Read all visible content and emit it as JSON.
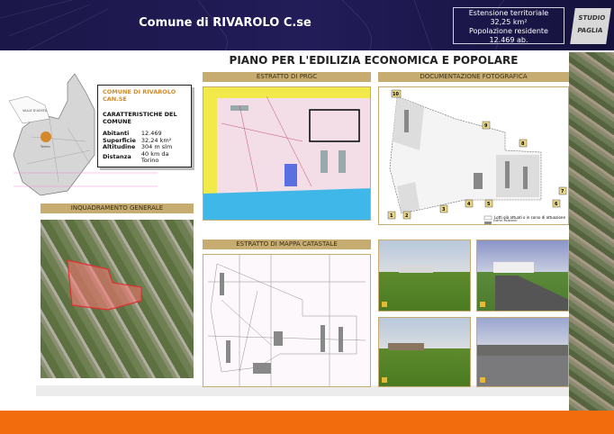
{
  "header": {
    "title": "Comune di RIVAROLO C.se",
    "info": {
      "line1": "Estensione territoriale",
      "line2": "32,25 km²",
      "line3": "Popolazione residente",
      "line4": "12.469 ab."
    },
    "logo": "STUDIO PAGLIA"
  },
  "page_title": "PIANO PER L'EDILIZIA ECONOMICA E POPOLARE",
  "map_box": {
    "name": "COMUNE DI RIVAROLO CAN.SE",
    "heading": "CARATTERISTICHE DEL COMUNE",
    "rows": [
      {
        "k": "Abitanti",
        "v": "12.469"
      },
      {
        "k": "Superficie",
        "v": "32,24 km²"
      },
      {
        "k": "Altitudine",
        "v": "304 m slm"
      },
      {
        "k": "Distanza",
        "v": "40 km da Torino"
      }
    ],
    "region_label": "VALLE D'AOSTA",
    "city_label": "Torino"
  },
  "sections": {
    "inquadramento": "INQUADRAMENTO GENERALE",
    "prgc": "ESTRATTO DI PRGC",
    "foto": "DOCUMENTAZIONE FOTOGRAFICA",
    "catastale": "ESTRATTO DI MAPPA CATASTALE"
  },
  "foto_plan": {
    "markers": [
      "1",
      "2",
      "3",
      "4",
      "5",
      "6",
      "7",
      "8",
      "9",
      "10"
    ],
    "legend": [
      "Lotti già attuati o in corso di attuazione",
      "Edifici esistenti"
    ]
  },
  "colors": {
    "header": "#1b1748",
    "accent": "#c7ac72",
    "orange": "#f26c0d"
  }
}
